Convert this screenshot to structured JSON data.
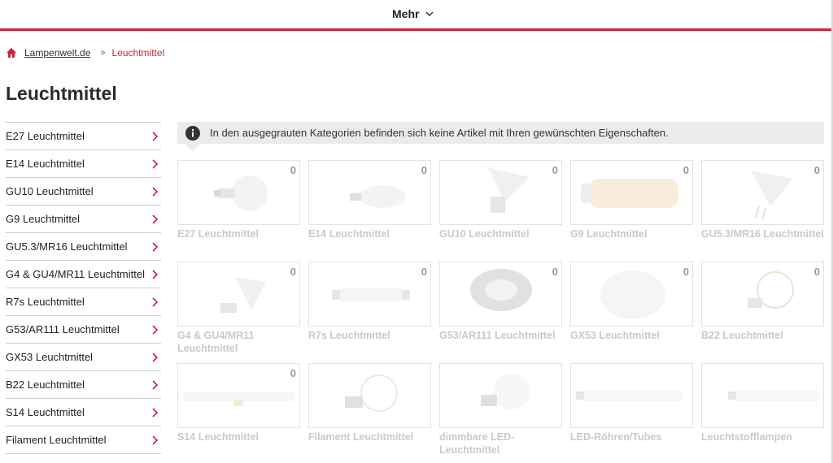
{
  "header": {
    "more_label": "Mehr"
  },
  "breadcrumb": {
    "home_label": "Lampenwelt.de",
    "separator": "»",
    "current": "Leuchtmittel"
  },
  "page_title": "Leuchtmittel",
  "sidebar": {
    "items": [
      {
        "label": "E27 Leuchtmittel"
      },
      {
        "label": "E14 Leuchtmittel"
      },
      {
        "label": "GU10 Leuchtmittel"
      },
      {
        "label": "G9 Leuchtmittel"
      },
      {
        "label": "GU5.3/MR16 Leuchtmittel"
      },
      {
        "label": "G4 & GU4/MR11 Leuchtmittel"
      },
      {
        "label": "R7s Leuchtmittel"
      },
      {
        "label": "G53/AR111 Leuchtmittel"
      },
      {
        "label": "GX53 Leuchtmittel"
      },
      {
        "label": "B22 Leuchtmittel"
      },
      {
        "label": "S14 Leuchtmittel"
      },
      {
        "label": "Filament Leuchtmittel"
      }
    ]
  },
  "notice": {
    "text": "In den ausgegrauten Kategorien befinden sich keine Artikel mit Ihren gewünschten Eigenschaften."
  },
  "categories": [
    {
      "label": "E27 Leuchtmittel",
      "count": "0",
      "icon": "bulb-a60-icon"
    },
    {
      "label": "E14 Leuchtmittel",
      "count": "0",
      "icon": "bulb-candle-icon"
    },
    {
      "label": "GU10 Leuchtmittel",
      "count": "0",
      "icon": "spot-gu10-icon"
    },
    {
      "label": "G9 Leuchtmittel",
      "count": "0",
      "icon": "capsule-g9-icon"
    },
    {
      "label": "GU5.3/MR16 Leuchtmittel",
      "count": "0",
      "icon": "spot-mr16-icon"
    },
    {
      "label": "G4 & GU4/MR11 Leuchtmittel",
      "count": "0",
      "icon": "spot-mr11-icon"
    },
    {
      "label": "R7s Leuchtmittel",
      "count": "0",
      "icon": "tube-r7s-icon"
    },
    {
      "label": "G53/AR111 Leuchtmittel",
      "count": "0",
      "icon": "reflector-ar111-icon"
    },
    {
      "label": "GX53 Leuchtmittel",
      "count": "0",
      "icon": "disc-gx53-icon"
    },
    {
      "label": "B22 Leuchtmittel",
      "count": "0",
      "icon": "bulb-filament-b22-icon"
    },
    {
      "label": "S14 Leuchtmittel",
      "count": "0",
      "icon": "linestra-s14-icon"
    },
    {
      "label": "Filament Leuchtmittel",
      "count": "",
      "icon": "bulb-filament-icon"
    },
    {
      "label": "dimmbare LED-Leuchtmittel",
      "count": "",
      "icon": "bulb-led-icon"
    },
    {
      "label": "LED-Röhren/Tubes",
      "count": "",
      "icon": "led-tube-icon"
    },
    {
      "label": "Leuchtstofflampen",
      "count": "",
      "icon": "fluorescent-tube-icon"
    }
  ],
  "colors": {
    "accent": "#d0223a",
    "muted_label": "#c9c9c9",
    "notice_bg": "#ebebeb"
  }
}
